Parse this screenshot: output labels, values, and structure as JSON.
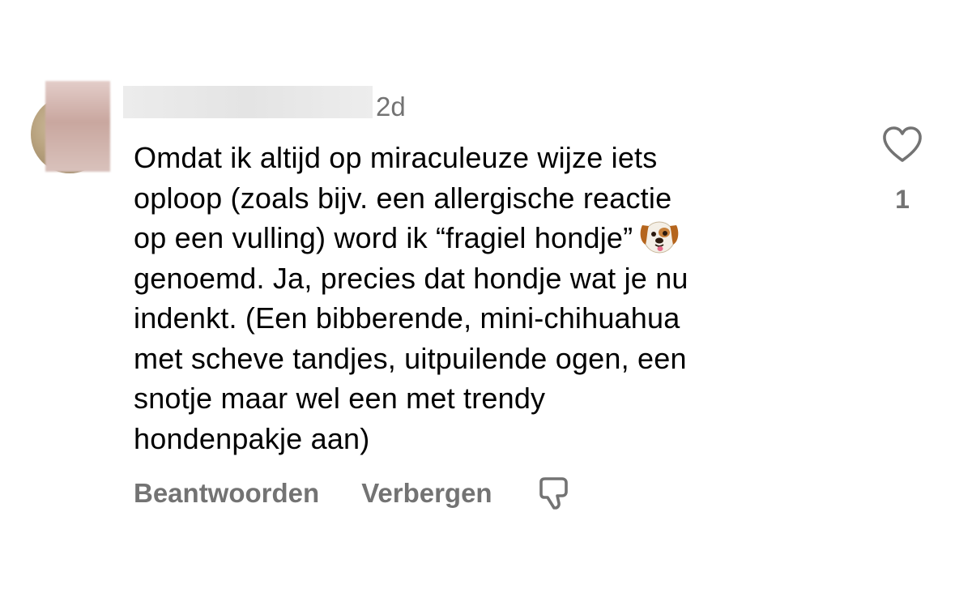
{
  "comment": {
    "timestamp": "2d",
    "text_lines": [
      "Omdat ik altijd op miraculeuze wijze iets",
      "oploop (zoals bijv. een allergische reactie",
      "op een vulling) word ik “fragiel hondje”",
      "genoemd. Ja, precies dat hondje wat je nu",
      "indenkt. (Een bibberende, mini-chihuahua",
      "met scheve tandjes, uitpuilende ogen, een",
      "snotje maar wel een met trendy",
      "hondenpakje aan)"
    ],
    "emoji": "dog-face-icon",
    "like_count": "1"
  },
  "actions": {
    "reply_label": "Beantwoorden",
    "hide_label": "Verbergen",
    "dislike_icon": "thumbs-down-icon"
  },
  "icons": {
    "like": "heart-icon"
  },
  "colors": {
    "text": "#000000",
    "secondary": "#737373",
    "background": "#ffffff"
  }
}
